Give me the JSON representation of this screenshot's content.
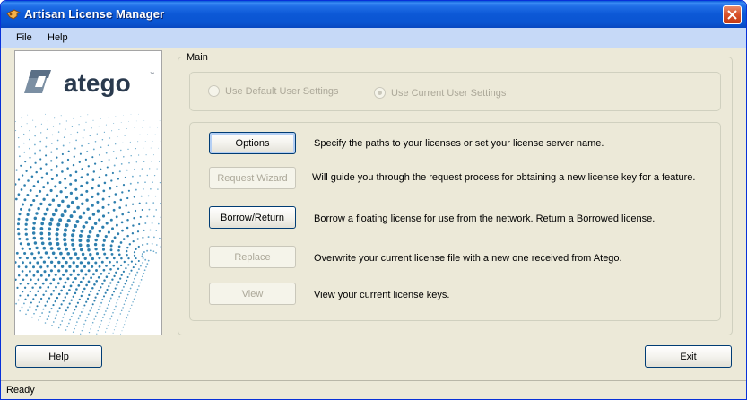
{
  "window": {
    "title": "Artisan License Manager"
  },
  "menu": {
    "items": [
      "File",
      "Help"
    ]
  },
  "logo": {
    "text": "atego",
    "trademark": "™"
  },
  "main": {
    "legend": "Main",
    "radios": [
      {
        "label": "Use Default User Settings",
        "selected": false,
        "enabled": false
      },
      {
        "label": "Use Current User Settings",
        "selected": true,
        "enabled": false
      }
    ],
    "commands": [
      {
        "label": "Options",
        "enabled": true,
        "description": "Specify the paths to your licenses or set your license server name."
      },
      {
        "label": "Request Wizard",
        "enabled": false,
        "description": "Will guide you through the request process for obtaining a new license key for a feature."
      },
      {
        "label": "Borrow/Return",
        "enabled": true,
        "description": "Borrow a floating license for use from the network.  Return a Borrowed license."
      },
      {
        "label": "Replace",
        "enabled": false,
        "description": "Overwrite your current license file with a new one received from Atego."
      },
      {
        "label": "View",
        "enabled": false,
        "description": "View your current license keys."
      }
    ]
  },
  "footer": {
    "help_label": "Help",
    "exit_label": "Exit"
  },
  "status": {
    "text": "Ready"
  },
  "colors": {
    "titlebar": "#0c58d6",
    "menubar": "#c6d9f7",
    "face": "#ece9d8",
    "accent_blue": "#003c74"
  }
}
